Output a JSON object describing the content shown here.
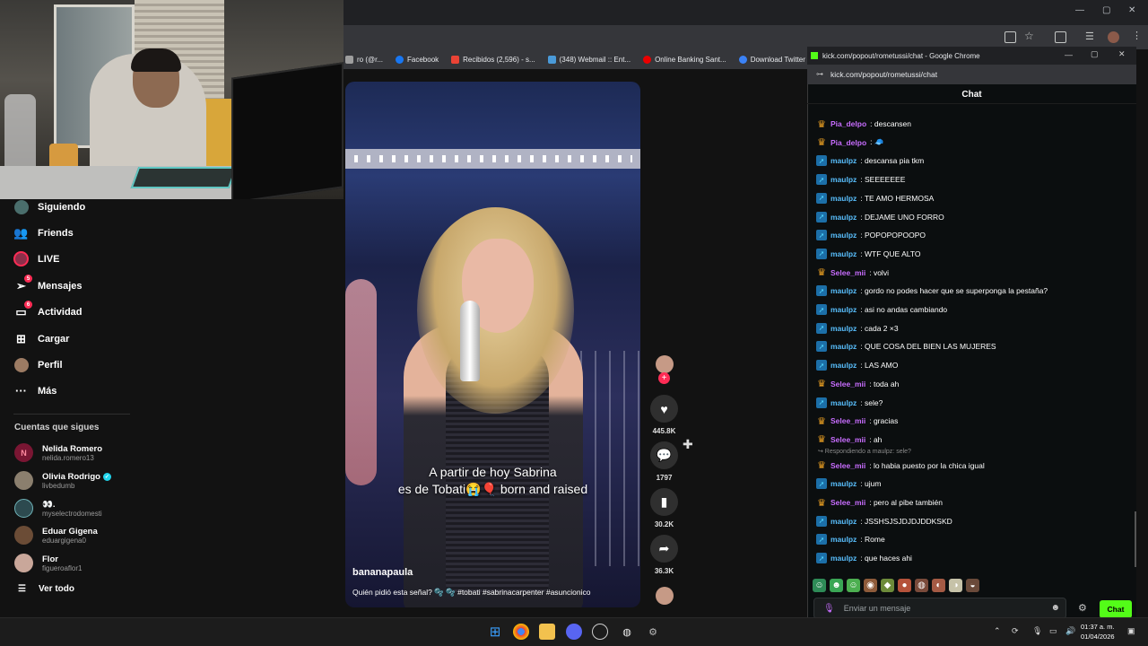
{
  "browser": {
    "bookmarks": [
      {
        "label": "ro (@r...",
        "color": "#e0e0e0"
      },
      {
        "label": "Facebook",
        "color": "#1877f2"
      },
      {
        "label": "Recibidos (2,596) - s...",
        "color": "#ea4335"
      },
      {
        "label": "(348) Webmail :: Ent...",
        "color": "#4a9ad8"
      },
      {
        "label": "Online Banking Sant...",
        "color": "#ec0000"
      },
      {
        "label": "Download Twitter Vi...",
        "color": "#3b82f6"
      }
    ]
  },
  "tiktok": {
    "nav": [
      {
        "label": "Siguiendo",
        "icon": "following-icon",
        "badge": ""
      },
      {
        "label": "Friends",
        "icon": "friends-icon",
        "badge": ""
      },
      {
        "label": "LIVE",
        "icon": "live-icon",
        "badge": ""
      },
      {
        "label": "Mensajes",
        "icon": "messages-icon",
        "badge": "5"
      },
      {
        "label": "Actividad",
        "icon": "activity-icon",
        "badge": "6"
      },
      {
        "label": "Cargar",
        "icon": "upload-icon",
        "badge": ""
      },
      {
        "label": "Perfil",
        "icon": "profile-icon",
        "badge": ""
      },
      {
        "label": "Más",
        "icon": "more-icon",
        "badge": ""
      }
    ],
    "following_title": "Cuentas que sigues",
    "accounts": [
      {
        "name": "Nelida Romero",
        "handle": "nelida.romero13",
        "initial": "N",
        "color": "#7a1633",
        "verified": false
      },
      {
        "name": "Olivia Rodrigo",
        "handle": "livbedumb",
        "initial": "",
        "color": "#8b7f6e",
        "verified": true
      },
      {
        "name": "👀.",
        "handle": "myselectrodomesti",
        "initial": "",
        "color": "#2d4a4f",
        "verified": false
      },
      {
        "name": "Eduar Gigena",
        "handle": "eduargigena0",
        "initial": "",
        "color": "#6b4c36",
        "verified": false
      },
      {
        "name": "Flor",
        "handle": "figueroaflor1",
        "initial": "",
        "color": "#c9a79a",
        "verified": false
      }
    ],
    "see_all": "Ver todo",
    "video": {
      "caption_line1": "A partir de hoy Sabrina",
      "caption_line2": "es de Tobati😭🎈 born and raised",
      "username": "bananapaula",
      "description": "Quién pidió esta señal? 🫧 🫧 #tobati #sabrinacarpenter #asuncionico"
    },
    "actions": {
      "likes": "445.8K",
      "comments": "1797",
      "saves": "30.2K",
      "shares": "36.3K"
    }
  },
  "chat_window": {
    "title": "kick.com/popout/rometussi/chat - Google Chrome",
    "url": "kick.com/popout/rometussi/chat",
    "header": "Chat",
    "messages": [
      {
        "user": "Pia_delpo",
        "text": ": descansen",
        "type": "crown"
      },
      {
        "user": "Pia_delpo",
        "text": ": 🧢",
        "type": "crown"
      },
      {
        "user": "maulpz",
        "text": ": descansa pia tkm",
        "type": "sub"
      },
      {
        "user": "maulpz",
        "text": ": SEEEEEEE",
        "type": "sub"
      },
      {
        "user": "maulpz",
        "text": ": TE AMO HERMOSA",
        "type": "sub"
      },
      {
        "user": "maulpz",
        "text": ": DEJAME UNO FORRO",
        "type": "sub"
      },
      {
        "user": "maulpz",
        "text": ": POPOPOPOOPO",
        "type": "sub"
      },
      {
        "user": "maulpz",
        "text": ": WTF QUE ALTO",
        "type": "sub"
      },
      {
        "user": "Selee_mii",
        "text": ": volvi",
        "type": "crown"
      },
      {
        "user": "maulpz",
        "text": ": gordo no podes hacer que se superponga la pestaña?",
        "type": "sub"
      },
      {
        "user": "maulpz",
        "text": ": asi no andas cambiando",
        "type": "sub"
      },
      {
        "user": "maulpz",
        "text": ": cada 2 ×3",
        "type": "sub"
      },
      {
        "user": "maulpz",
        "text": ": QUE COSA DEL BIEN LAS MUJERES",
        "type": "sub"
      },
      {
        "user": "maulpz",
        "text": ": LAS AMO",
        "type": "sub"
      },
      {
        "user": "Selee_mii",
        "text": ": toda ah",
        "type": "crown"
      },
      {
        "user": "maulpz",
        "text": ": sele?",
        "type": "sub"
      },
      {
        "user": "Selee_mii",
        "text": ": gracias",
        "type": "crown"
      },
      {
        "user": "Selee_mii",
        "text": ": ah",
        "type": "crown"
      },
      {
        "user": "Selee_mii",
        "text": ": lo habia puesto por la chica igual",
        "type": "crown",
        "reply": "Respondiendo a maulpz: sele?"
      },
      {
        "user": "maulpz",
        "text": ": ujum",
        "type": "sub"
      },
      {
        "user": "Selee_mii",
        "text": ": pero al pibe también",
        "type": "crown"
      },
      {
        "user": "maulpz",
        "text": ": JSSHSJSJDJDJDDKSKD",
        "type": "sub"
      },
      {
        "user": "maulpz",
        "text": ": Rome",
        "type": "sub"
      },
      {
        "user": "maulpz",
        "text": ": que haces ahi",
        "type": "sub"
      }
    ],
    "input_placeholder": "Enviar un mensaje",
    "send_label": "Chat",
    "accent": "#53fc18"
  },
  "taskbar": {
    "time": "01:37 a. m.",
    "date": "01/04/2026"
  }
}
